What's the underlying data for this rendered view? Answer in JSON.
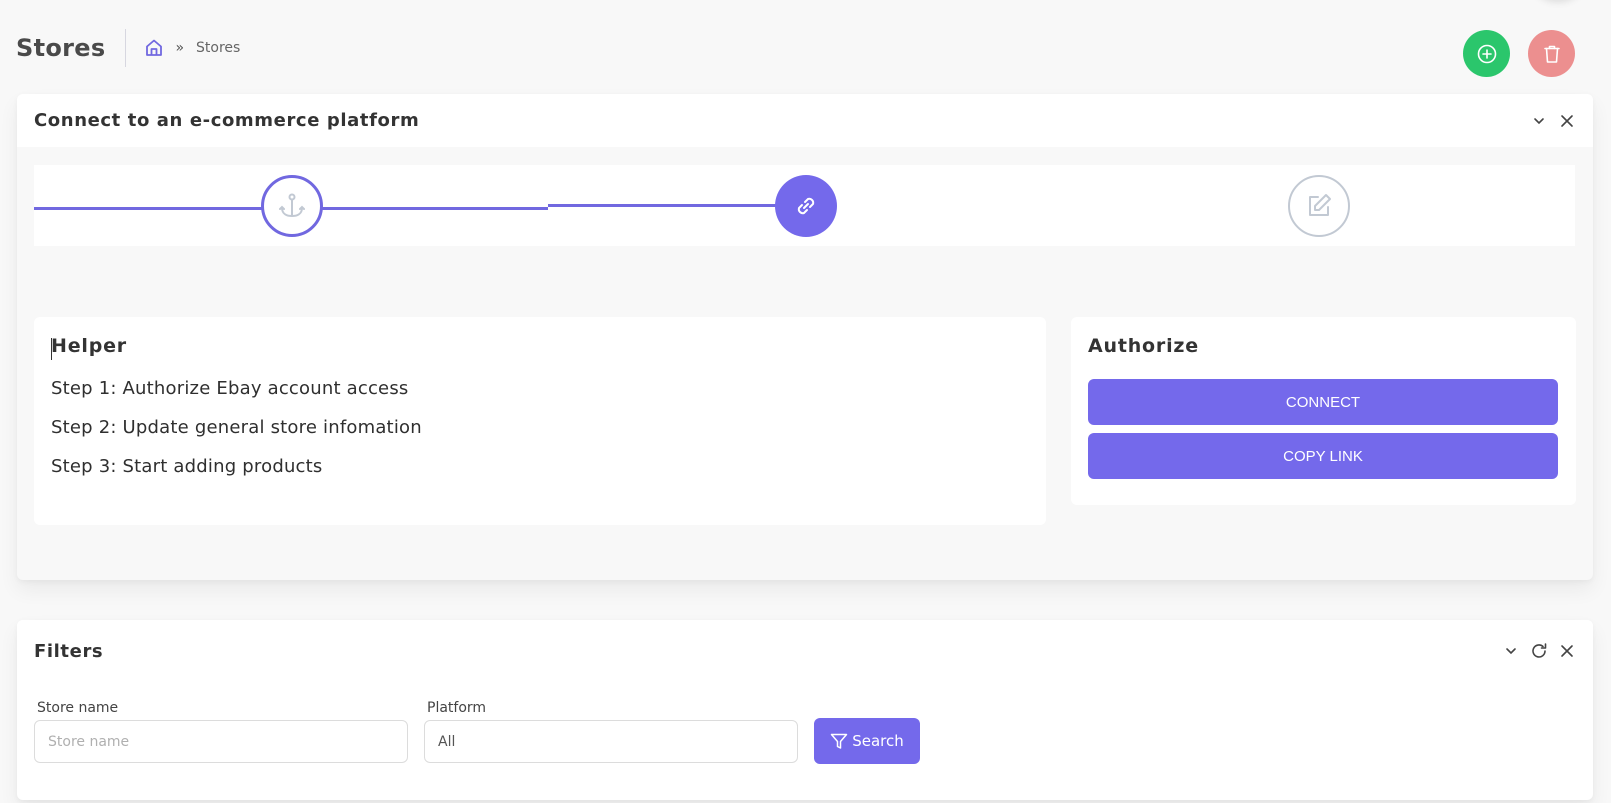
{
  "header": {
    "title": "Stores",
    "breadcrumb": {
      "home_icon": "home-icon",
      "separator": "»",
      "current": "Stores"
    },
    "actions": {
      "add_icon": "plus-circle-icon",
      "delete_icon": "trash-icon"
    }
  },
  "colors": {
    "accent": "#7469eb",
    "success": "#2bc66c",
    "danger": "#ec8f8f",
    "pending": "#c2c9d3"
  },
  "connect_card": {
    "title": "Connect to an e-commerce platform",
    "tools": [
      "chevron-down-icon",
      "close-icon"
    ],
    "stepper": {
      "steps": [
        {
          "icon": "anchor-icon",
          "state": "done"
        },
        {
          "icon": "link-icon",
          "state": "active"
        },
        {
          "icon": "edit-icon",
          "state": "pending"
        }
      ]
    },
    "helper": {
      "title": "Helper",
      "steps": [
        "Step 1: Authorize Ebay account access",
        "Step 2: Update general store infomation",
        "Step 3: Start adding products"
      ]
    },
    "authorize": {
      "title": "Authorize",
      "connect_label": "CONNECT",
      "copy_link_label": "COPY LINK"
    }
  },
  "filters_card": {
    "title": "Filters",
    "tools": [
      "chevron-down-icon",
      "refresh-icon",
      "close-icon"
    ],
    "store_name": {
      "label": "Store name",
      "placeholder": "Store name",
      "value": ""
    },
    "platform": {
      "label": "Platform",
      "value": "All"
    },
    "search_label": "Search",
    "search_icon": "filter-icon"
  }
}
